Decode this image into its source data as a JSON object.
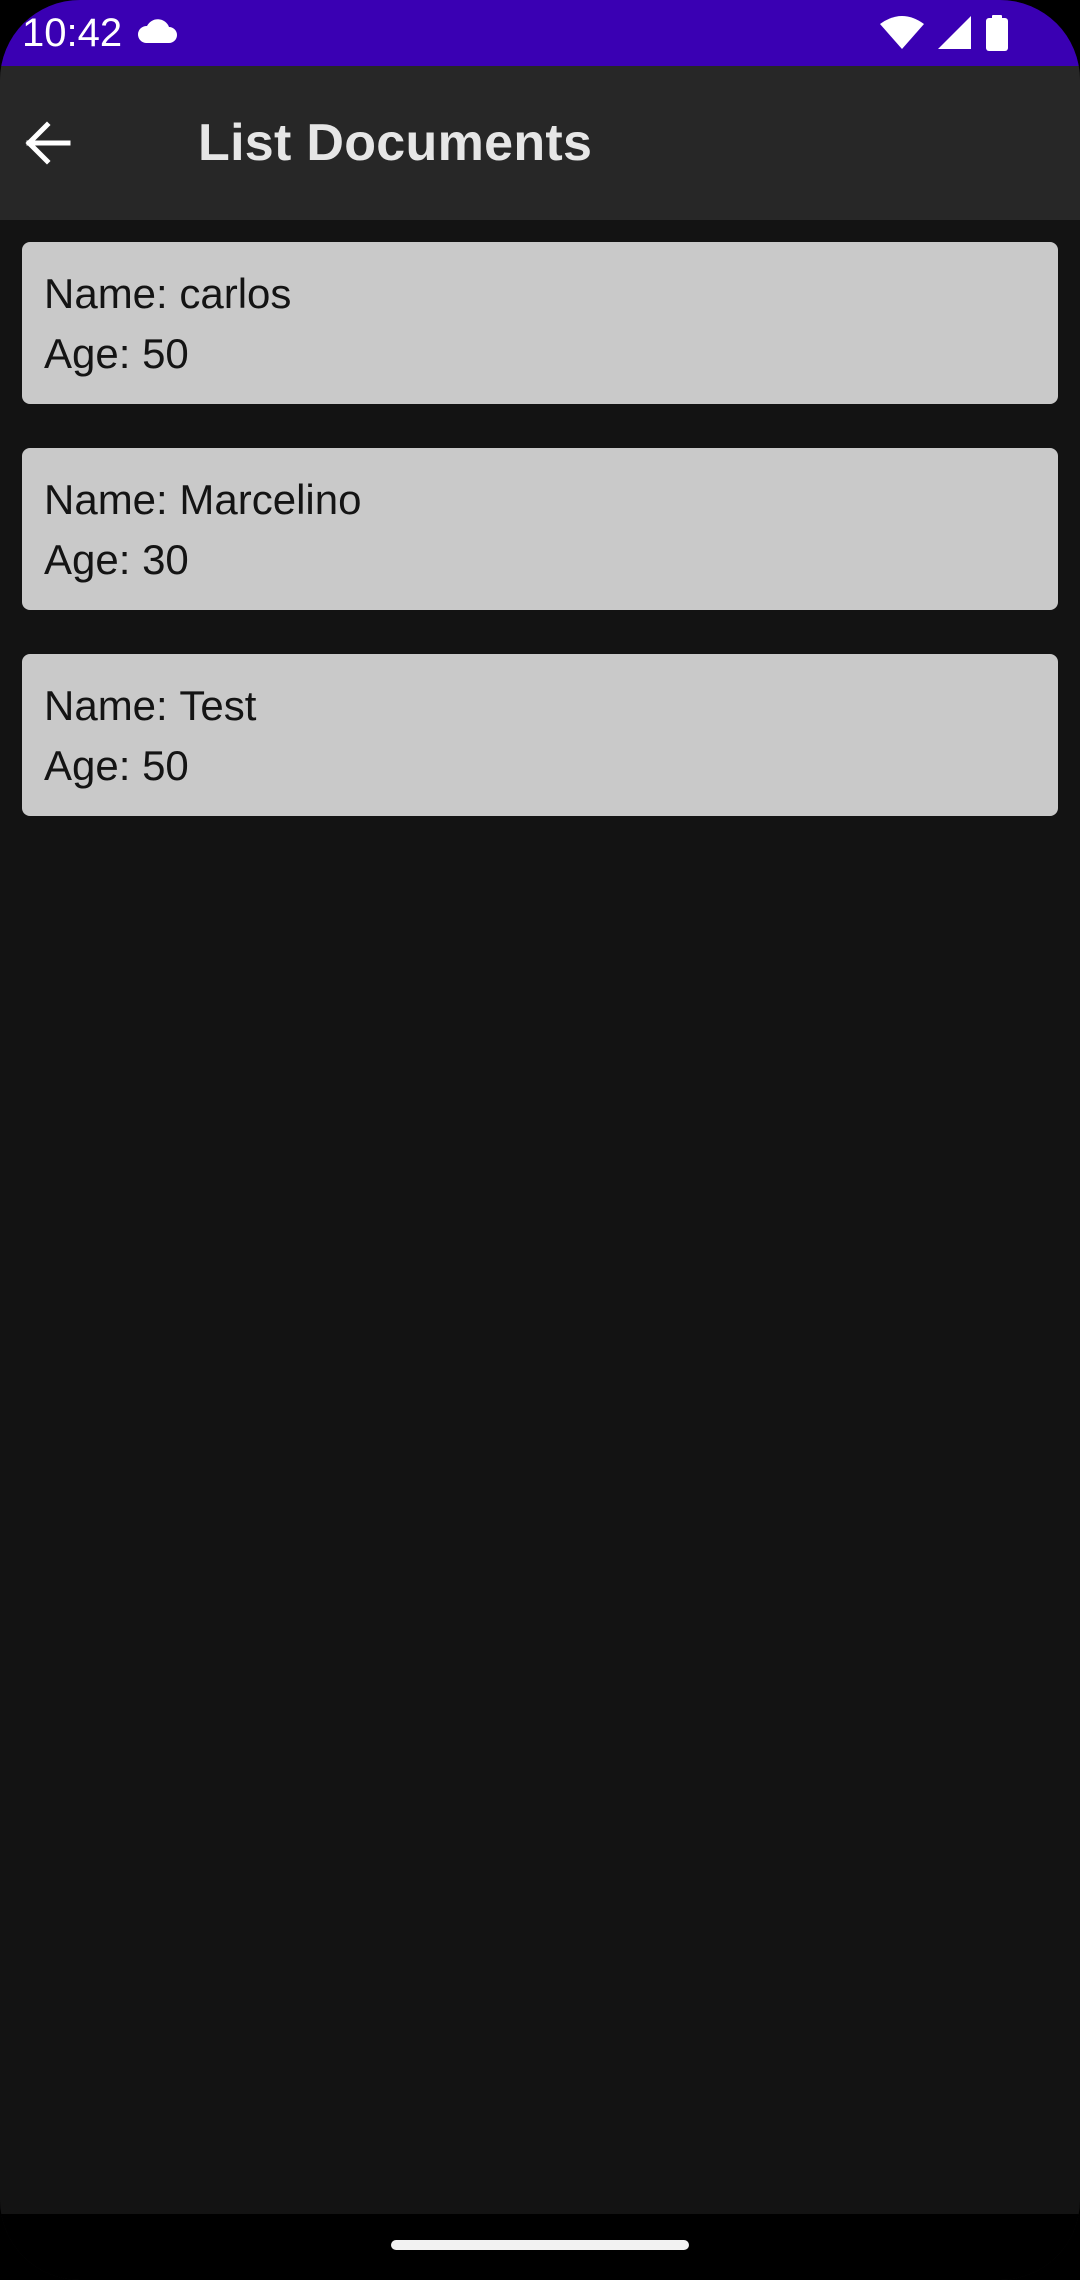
{
  "status_bar": {
    "time": "10:42",
    "background_color": "#3a00b3",
    "icons": [
      "cloud-icon",
      "wifi-icon",
      "cell-signal-icon",
      "battery-icon"
    ]
  },
  "app_bar": {
    "title": "List Documents",
    "back_icon": "arrow-left-icon",
    "background_color": "#272727"
  },
  "documents": [
    {
      "name_label": "Name: ",
      "name": "carlos",
      "age_label": "Age: ",
      "age": "50"
    },
    {
      "name_label": "Name: ",
      "name": "Marcelino",
      "age_label": "Age: ",
      "age": "30"
    },
    {
      "name_label": "Name: ",
      "name": "Test",
      "age_label": "Age: ",
      "age": "50"
    }
  ],
  "colors": {
    "screen_background": "#131313",
    "card_background": "#c9c9c9",
    "card_text": "#141414",
    "title_text": "#e6e6e6"
  }
}
